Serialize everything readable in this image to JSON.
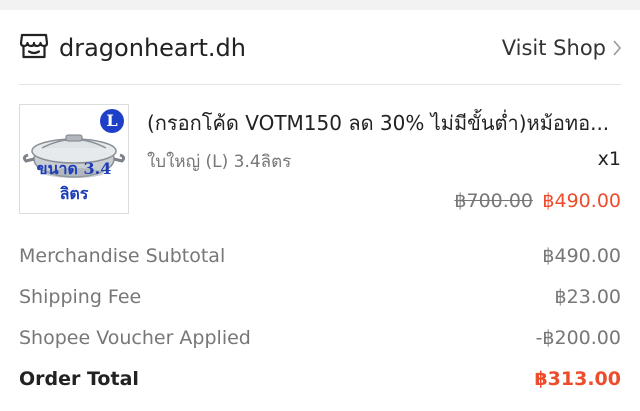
{
  "shop": {
    "name": "dragonheart.dh",
    "visit_label": "Visit Shop",
    "icon": "shop-icon"
  },
  "product": {
    "title": "(กรอกโค้ด VOTM150 ลด 30% ไม่มีขั้นต่ำ)หม้อทอ...",
    "variant": "ใบใหญ่ (L) 3.4ลิตร",
    "quantity": "x1",
    "original_price": "฿700.00",
    "price": "฿490.00",
    "thumb_badge": "L",
    "thumb_caption": "ขนาด 3.4 ลิตร"
  },
  "summary": {
    "rows": [
      {
        "label": "Merchandise Subtotal",
        "value": "฿490.00"
      },
      {
        "label": "Shipping Fee",
        "value": "฿23.00"
      },
      {
        "label": "Shopee Voucher Applied",
        "value": "-฿200.00"
      }
    ],
    "total": {
      "label": "Order Total",
      "value": "฿313.00"
    }
  },
  "colors": {
    "accent": "#ee4d2d",
    "muted": "#777777",
    "badge": "#1e40c8"
  }
}
